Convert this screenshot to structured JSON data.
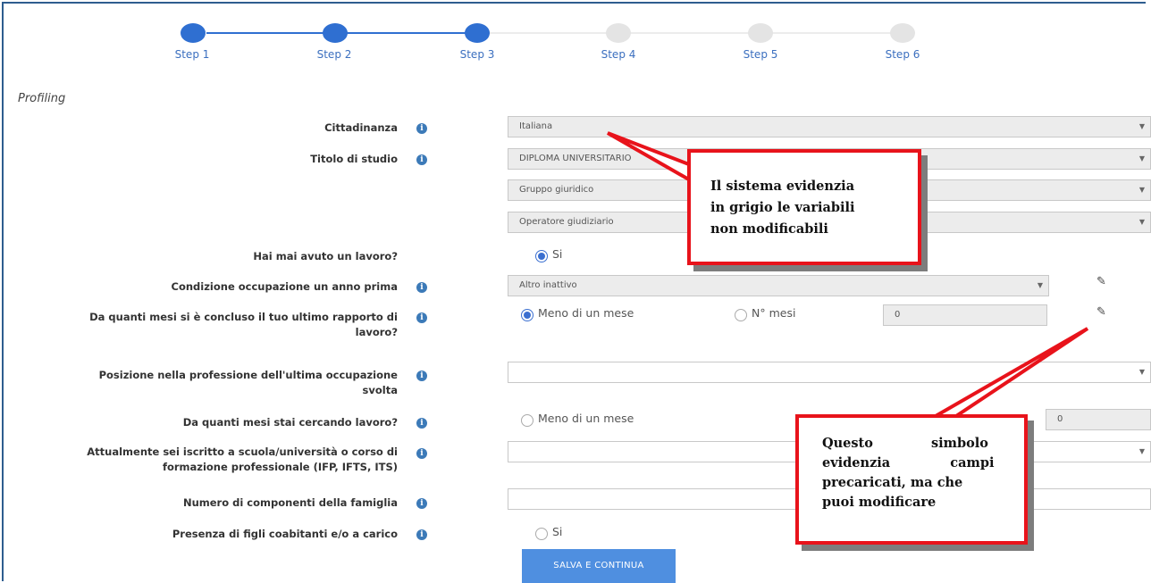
{
  "stepper": {
    "steps": [
      {
        "label": "Step 1",
        "state": "done"
      },
      {
        "label": "Step 2",
        "state": "done"
      },
      {
        "label": "Step 3",
        "state": "current"
      },
      {
        "label": "Step 4",
        "state": "todo"
      },
      {
        "label": "Step 5",
        "state": "todo"
      },
      {
        "label": "Step 6",
        "state": "todo"
      }
    ],
    "active_color": "#2f6fd1",
    "inactive_color": "#e4e4e4"
  },
  "section_title": "Profiling",
  "form": {
    "cittadinanza": {
      "label": "Cittadinanza",
      "value": "Italiana"
    },
    "titolo_studio": {
      "label": "Titolo di studio",
      "value1": "DIPLOMA UNIVERSITARIO",
      "value2": "Gruppo giuridico",
      "value3": "Operatore giudiziario"
    },
    "lavoro": {
      "label": "Hai mai avuto un lavoro?",
      "option": "Si"
    },
    "condizione": {
      "label": "Condizione occupazione un anno prima",
      "value": "Altro inattivo"
    },
    "mesi_concluso": {
      "label_line1": "Da quanti mesi si è concluso il tuo ultimo rapporto di",
      "label_line2": "lavoro?",
      "option1": "Meno di un mese",
      "option2": "N° mesi",
      "value": "0"
    },
    "posizione": {
      "label_line1": "Posizione nella professione dell'ultima occupazione",
      "label_line2": "svolta",
      "value": ""
    },
    "mesi_cercando": {
      "label": "Da quanti mesi stai cercando lavoro?",
      "option1": "Meno di un mese",
      "value": "0"
    },
    "iscritto": {
      "label_line1": "Attualmente sei iscritto a scuola/università o corso di",
      "label_line2": "formazione professionale (IFP, IFTS, ITS)",
      "value": ""
    },
    "famiglia": {
      "label": "Numero di componenti della famiglia",
      "value": ""
    },
    "figli": {
      "label": "Presenza di figli coabitanti e/o a carico",
      "option": "Si"
    }
  },
  "submit_label": "SALVA E CONTINUA",
  "callouts": {
    "grey": {
      "line1": "Il sistema evidenzia",
      "line2": "in grigio le variabili",
      "line3": "non modificabili"
    },
    "pencil": {
      "line1": "Questo simbolo",
      "line2": "evidenzia campi",
      "line3": "precaricati, ma che",
      "line4": "puoi modificare"
    }
  },
  "icons": {
    "info": "info-circle-icon",
    "edit": "pencil-icon",
    "caret": "caret-down-icon"
  },
  "colors": {
    "annotation_red": "#e8131b",
    "button_blue": "#4f8fe0"
  }
}
